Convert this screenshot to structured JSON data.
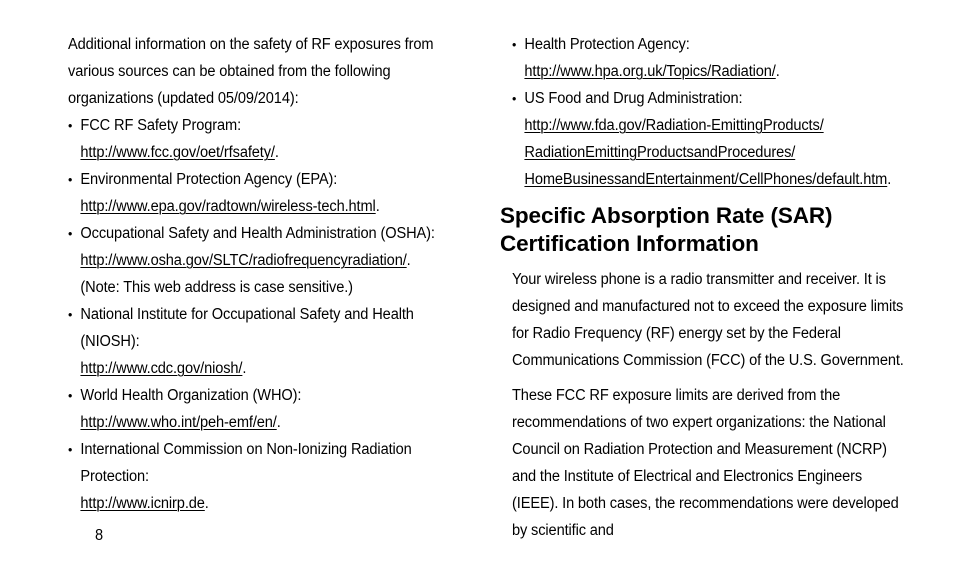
{
  "page": {
    "number": "8"
  },
  "left_column": {
    "intro_paragraph": "Additional information on the safety of RF exposures from various sources can be obtained from the following organizations (updated 05/09/2014):",
    "organizations": [
      {
        "name": "FCC RF Safety Program:",
        "url": "http://www.fcc.gov/oet/rfsafety/",
        "url_suffix": ".",
        "note": ""
      },
      {
        "name": "Environmental Protection Agency (EPA):",
        "url": "http://www.epa.gov/radtown/wireless-tech.html",
        "url_suffix": ".",
        "note": ""
      },
      {
        "name": "Occupational Safety and Health Administration (OSHA):",
        "url": "http://www.osha.gov/SLTC/radiofrequencyradiation/",
        "url_suffix": ".",
        "note": "(Note: This web address is case sensitive.)"
      },
      {
        "name": "National Institute for Occupational Safety and Health (NIOSH):",
        "url": "http://www.cdc.gov/niosh/",
        "url_suffix": ".",
        "note": ""
      },
      {
        "name": "World Health Organization (WHO):",
        "url": "http://www.who.int/peh-emf/en/",
        "url_suffix": ".",
        "note": ""
      },
      {
        "name": "International Commission on Non-Ionizing Radiation Protection:",
        "url": "http://www.icnirp.de",
        "url_suffix": ".",
        "note": ""
      }
    ]
  },
  "right_column": {
    "organizations": [
      {
        "name": "Health Protection Agency:",
        "url": "http://www.hpa.org.uk/Topics/Radiation/",
        "url_suffix": ".",
        "url_line2": "",
        "url_line3": ""
      },
      {
        "name": "US Food and Drug Administration:",
        "url": "http://www.fda.gov/Radiation-EmittingProducts/",
        "url_line2": "RadiationEmittingProductsandProcedures/",
        "url_line3": "HomeBusinessandEntertainment/CellPhones/default.htm",
        "url_suffix": "."
      }
    ],
    "heading_line1": "Specific Absorption Rate (SAR)",
    "heading_line2": "Certification Information",
    "paragraph_1": "Your wireless phone is a radio transmitter and receiver. It is designed and manufactured not to exceed the exposure limits for Radio Frequency (RF) energy set by the Federal Communications Commission (FCC) of the U.S. Government.",
    "paragraph_2": "These FCC RF exposure limits are derived from the recommendations of two expert organizations: the National Council on Radiation Protection and Measurement (NCRP) and the Institute of Electrical and Electronics Engineers (IEEE). In both cases, the recommendations were developed by scientific and"
  }
}
